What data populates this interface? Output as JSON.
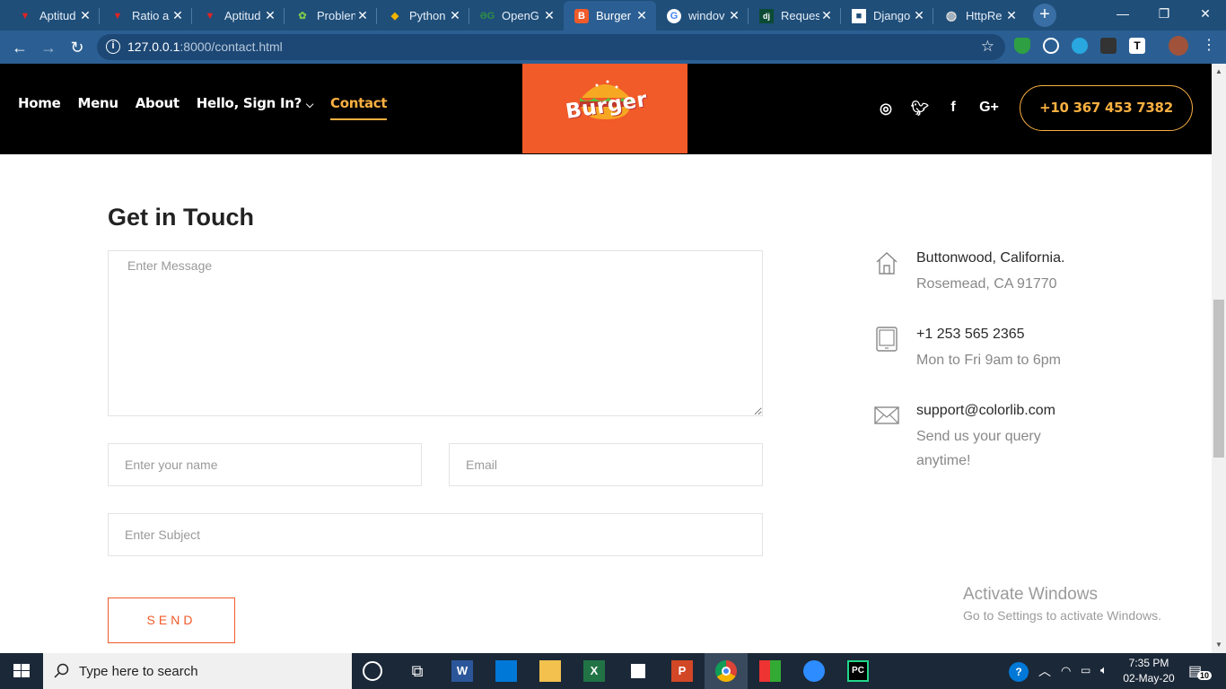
{
  "browser": {
    "tabs": [
      {
        "title": "Aptitud",
        "icon": "red-v-icon",
        "color": "#e02424"
      },
      {
        "title": "Ratio a",
        "icon": "red-v-icon",
        "color": "#e02424"
      },
      {
        "title": "Aptitud",
        "icon": "red-v-icon",
        "color": "#e02424"
      },
      {
        "title": "Problen",
        "icon": "hackerrank-icon",
        "color": "#7ac74f"
      },
      {
        "title": "Python",
        "icon": "colab-icon",
        "color": "#f4b400"
      },
      {
        "title": "OpenG",
        "icon": "gfg-icon",
        "color": "#2f8d46"
      },
      {
        "title": "Burger",
        "icon": "burger-favicon-icon",
        "color": "#f15a29"
      },
      {
        "title": "windov",
        "icon": "google-icon",
        "color": "#4285f4"
      },
      {
        "title": "Reques",
        "icon": "django-icon",
        "color": "#0c4b33"
      },
      {
        "title": "Django",
        "icon": "square-icon",
        "color": "#ffffff"
      },
      {
        "title": "HttpRe",
        "icon": "globe-icon",
        "color": "#cccccc"
      }
    ],
    "url_host": "127.0.0.1",
    "url_rest": ":8000/contact.html"
  },
  "site": {
    "nav": [
      "Home",
      "Menu",
      "About",
      "Hello, Sign In?",
      "Contact"
    ],
    "logo_text": "Burger",
    "phone": "+10 367 453 7382",
    "accent": "#fbb040",
    "brand": "#f15a29"
  },
  "contact": {
    "title": "Get in Touch",
    "message_placeholder": "Enter Message",
    "name_placeholder": "Enter your name",
    "email_placeholder": "Email",
    "subject_placeholder": "Enter Subject",
    "send_label": "SEND",
    "address_line1": "Buttonwood, California.",
    "address_line2": "Rosemead, CA 91770",
    "phone_line1": "+1 253 565 2365",
    "phone_line2": "Mon to Fri 9am to 6pm",
    "email_line1": "support@colorlib.com",
    "email_line2": "Send us your query anytime!"
  },
  "watermark": {
    "line1": "Activate Windows",
    "line2": "Go to Settings to activate Windows."
  },
  "taskbar": {
    "search_text": "Type here to search",
    "time": "7:35 PM",
    "date": "02-May-20",
    "notifications": "10"
  }
}
